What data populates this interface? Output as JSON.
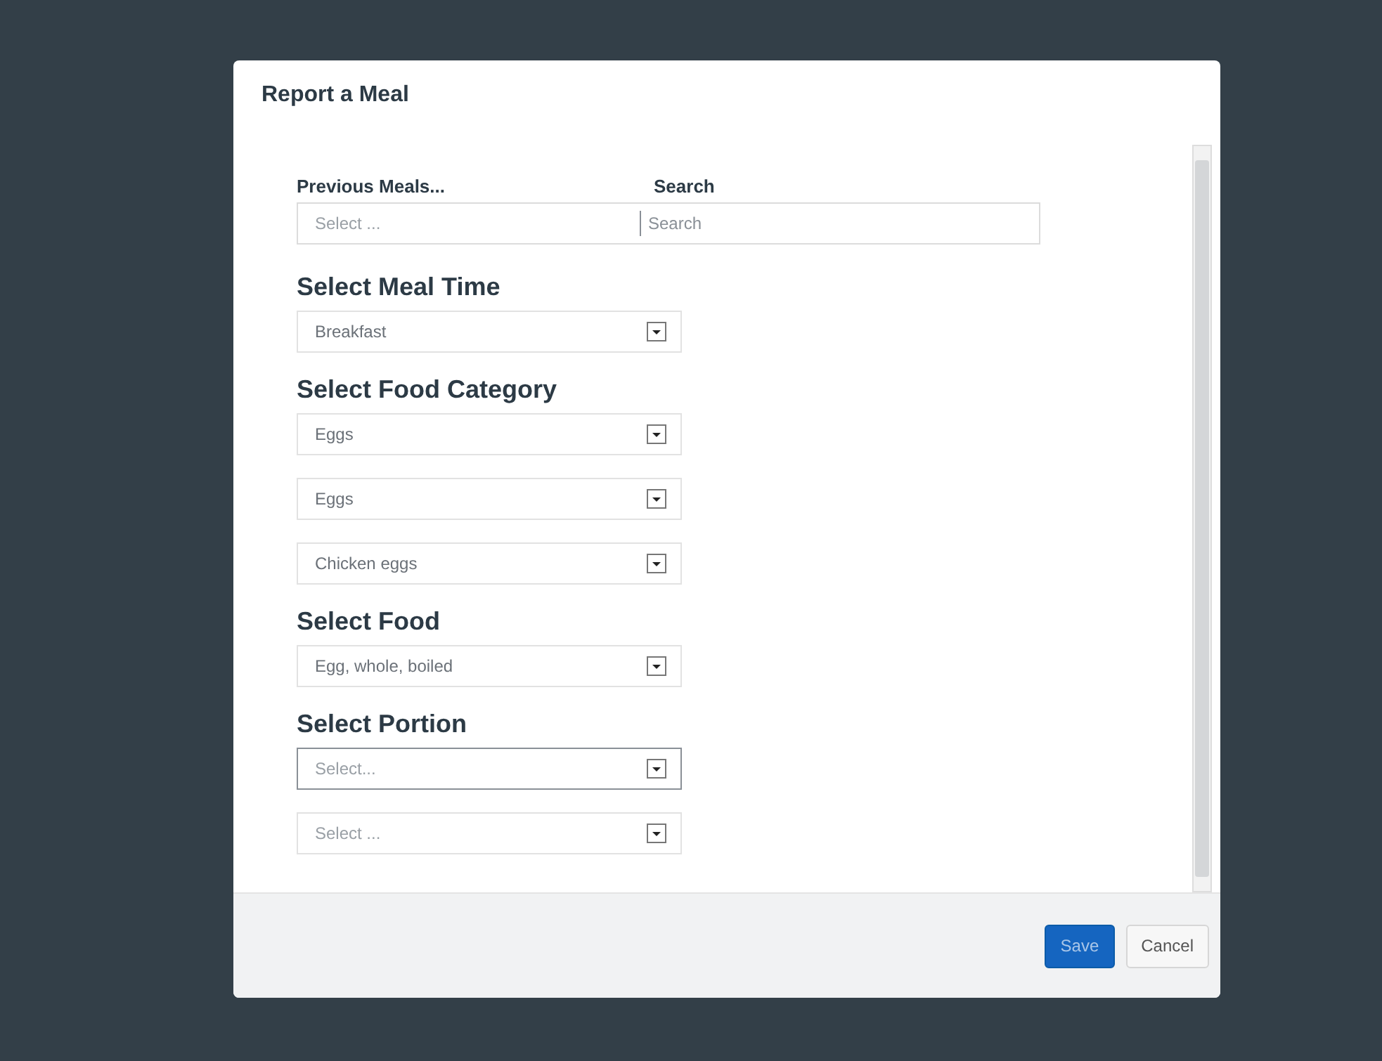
{
  "dialog": {
    "title": "Report a Meal"
  },
  "top_row": {
    "previous_label": "Previous Meals...",
    "previous_placeholder": "Select ...",
    "search_label": "Search",
    "search_placeholder": "Search"
  },
  "sections": [
    {
      "heading": "Select Meal Time",
      "selects": [
        {
          "value": "Breakfast",
          "kind": "value",
          "focused": false
        }
      ]
    },
    {
      "heading": "Select Food Category",
      "selects": [
        {
          "value": "Eggs",
          "kind": "value",
          "focused": false
        },
        {
          "value": "Eggs",
          "kind": "value",
          "focused": false
        },
        {
          "value": "Chicken eggs",
          "kind": "value",
          "focused": false
        }
      ]
    },
    {
      "heading": "Select Food",
      "selects": [
        {
          "value": "Egg, whole, boiled",
          "kind": "value",
          "focused": false
        }
      ]
    },
    {
      "heading": "Select Portion",
      "selects": [
        {
          "value": "Select...",
          "kind": "placeholder",
          "focused": true
        },
        {
          "value": "Select ...",
          "kind": "placeholder",
          "focused": false
        }
      ]
    }
  ],
  "buttons": [
    {
      "label": "Save",
      "kind": "primary"
    },
    {
      "label": "Cancel",
      "kind": "secondary"
    }
  ]
}
